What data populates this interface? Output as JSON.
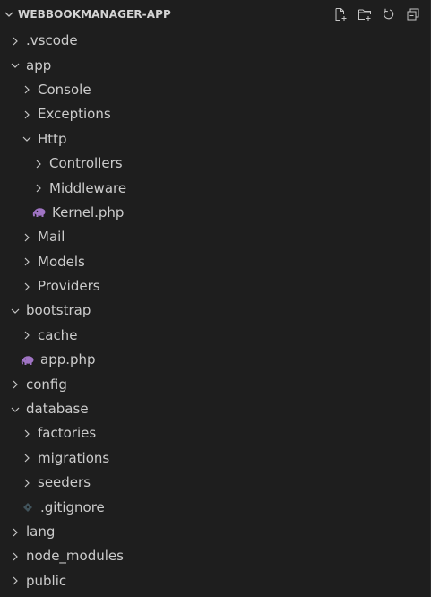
{
  "explorer": {
    "title": "WEBBOOKMANAGER-APP",
    "actions": [
      {
        "name": "new-file",
        "icon": "new-file-icon"
      },
      {
        "name": "new-folder",
        "icon": "new-folder-icon"
      },
      {
        "name": "refresh",
        "icon": "refresh-icon"
      },
      {
        "name": "collapse-all",
        "icon": "collapse-all-icon"
      }
    ],
    "items": [
      {
        "label": ".vscode",
        "type": "folder",
        "expanded": false,
        "depth": 1
      },
      {
        "label": "app",
        "type": "folder",
        "expanded": true,
        "depth": 1
      },
      {
        "label": "Console",
        "type": "folder",
        "expanded": false,
        "depth": 2
      },
      {
        "label": "Exceptions",
        "type": "folder",
        "expanded": false,
        "depth": 2
      },
      {
        "label": "Http",
        "type": "folder",
        "expanded": true,
        "depth": 2
      },
      {
        "label": "Controllers",
        "type": "folder",
        "expanded": false,
        "depth": 3
      },
      {
        "label": "Middleware",
        "type": "folder",
        "expanded": false,
        "depth": 3
      },
      {
        "label": "Kernel.php",
        "type": "file",
        "icon": "php-elephant-icon",
        "depth": 3
      },
      {
        "label": "Mail",
        "type": "folder",
        "expanded": false,
        "depth": 2
      },
      {
        "label": "Models",
        "type": "folder",
        "expanded": false,
        "depth": 2
      },
      {
        "label": "Providers",
        "type": "folder",
        "expanded": false,
        "depth": 2
      },
      {
        "label": "bootstrap",
        "type": "folder",
        "expanded": true,
        "depth": 1
      },
      {
        "label": "cache",
        "type": "folder",
        "expanded": false,
        "depth": 2
      },
      {
        "label": "app.php",
        "type": "file",
        "icon": "php-elephant-icon",
        "depth": 2
      },
      {
        "label": "config",
        "type": "folder",
        "expanded": false,
        "depth": 1
      },
      {
        "label": "database",
        "type": "folder",
        "expanded": true,
        "depth": 1
      },
      {
        "label": "factories",
        "type": "folder",
        "expanded": false,
        "depth": 2
      },
      {
        "label": "migrations",
        "type": "folder",
        "expanded": false,
        "depth": 2
      },
      {
        "label": "seeders",
        "type": "folder",
        "expanded": false,
        "depth": 2
      },
      {
        "label": ".gitignore",
        "type": "file",
        "icon": "git-diamond-icon",
        "depth": 2
      },
      {
        "label": "lang",
        "type": "folder",
        "expanded": false,
        "depth": 1
      },
      {
        "label": "node_modules",
        "type": "folder",
        "expanded": false,
        "depth": 1
      },
      {
        "label": "public",
        "type": "folder",
        "expanded": false,
        "depth": 1
      }
    ]
  },
  "colors": {
    "background": "#1e1e1e",
    "text": "#cccccc",
    "chevron": "#c5c5c5",
    "php_icon": "#a074c4",
    "git_icon": "#41535b"
  }
}
